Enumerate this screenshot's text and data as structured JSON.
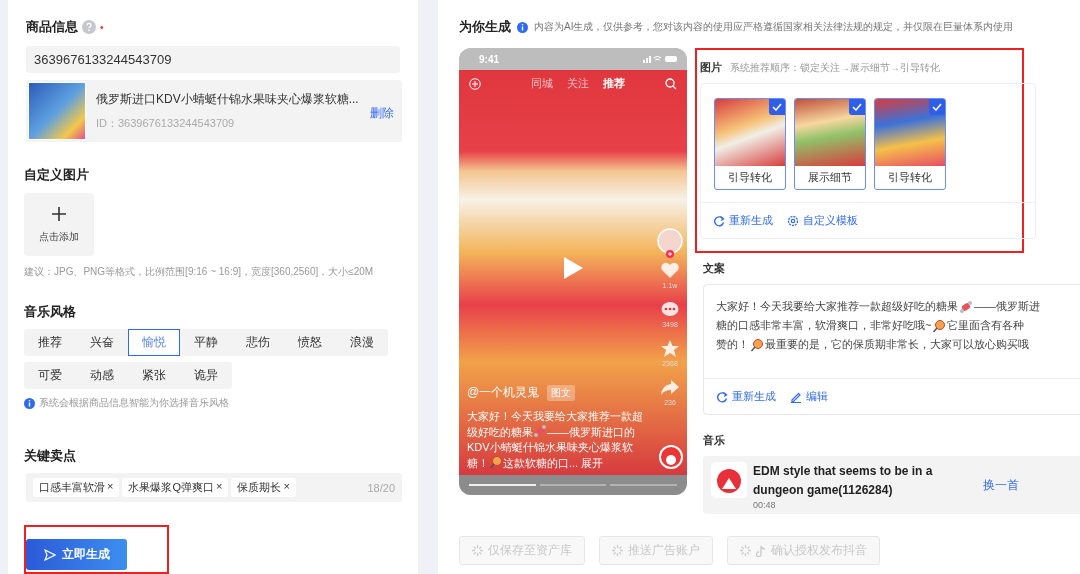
{
  "product": {
    "title": "商品信息",
    "required_mark": "•",
    "id_value": "3639676133244543709",
    "card_name": "俄罗斯进口KDV小蜻蜓什锦水果味夹心爆浆软糖...",
    "card_id": "ID：3639676133244543709",
    "delete_link": "删除"
  },
  "custom_image": {
    "title": "自定义图片",
    "add_label": "点击添加",
    "hint": "建议：JPG、PNG等格式，比例范围[9:16 ~ 16:9]，宽度[360,2560]，大小≤20M"
  },
  "music_style": {
    "title": "音乐风格",
    "rows": [
      [
        {
          "label": "推荐",
          "selected": false
        },
        {
          "label": "兴奋",
          "selected": false
        },
        {
          "label": "愉悦",
          "selected": true
        },
        {
          "label": "平静",
          "selected": false
        },
        {
          "label": "悲伤",
          "selected": false
        },
        {
          "label": "愤怒",
          "selected": false
        },
        {
          "label": "浪漫",
          "selected": false
        }
      ],
      [
        {
          "label": "可爱",
          "selected": false
        },
        {
          "label": "动感",
          "selected": false
        },
        {
          "label": "紧张",
          "selected": false
        },
        {
          "label": "诡异",
          "selected": false
        }
      ]
    ],
    "note": "系统会根据商品信息智能为你选择音乐风格"
  },
  "selling_points": {
    "title": "关键卖点",
    "tags": [
      "口感丰富软滑",
      "水果爆浆Q弹爽口",
      "保质期长"
    ],
    "remove_mark": "×",
    "count": "18/20"
  },
  "generate_button": {
    "label": "立即生成"
  },
  "result": {
    "title": "为你生成",
    "notice": "内容为AI生成，仅供参考，您对该内容的使用应严格遵循国家相关法律法规的规定，并仅限在巨量体系内使用"
  },
  "phone": {
    "time": "9:41",
    "tabs": [
      {
        "label": "同城",
        "selected": false
      },
      {
        "label": "关注",
        "selected": false
      },
      {
        "label": "推荐",
        "selected": true
      }
    ],
    "counts": [
      "1.1w",
      "3498",
      "2368",
      "236"
    ],
    "author": "@一个机灵鬼",
    "badge": "图文",
    "caption": [
      {
        "kind": "text",
        "text": "大家好！今天我要给大家推荐一款超级好吃的糖果"
      },
      {
        "kind": "candy"
      },
      {
        "kind": "text",
        "text": "——俄罗斯进口的KDV小蜻蜓什锦水果味夹心爆浆软糖！"
      },
      {
        "kind": "lollipop"
      },
      {
        "kind": "text",
        "text": "这款软糖的口... "
      },
      {
        "kind": "link",
        "text": "展开"
      }
    ]
  },
  "images": {
    "title": "图片",
    "order_hint": "系统推荐顺序：锁定关注→展示细节→引导转化",
    "items": [
      {
        "label": "引导转化",
        "checked": true
      },
      {
        "label": "展示细节",
        "checked": true
      },
      {
        "label": "引导转化",
        "checked": true
      }
    ],
    "actions": [
      "重新生成",
      "自定义模板"
    ]
  },
  "copy": {
    "title": "文案",
    "lines": [
      [
        {
          "kind": "text",
          "text": "大家好！今天我要给大家推荐一款超级好吃的糖果"
        },
        {
          "kind": "candy"
        },
        {
          "kind": "text",
          "text": "——俄罗斯进"
        }
      ],
      [
        {
          "kind": "text",
          "text": "糖的口感非常丰富，软滑爽口，非常好吃哦~ "
        },
        {
          "kind": "lollipop"
        },
        {
          "kind": "text",
          "text": "它里面含有各种"
        }
      ],
      [
        {
          "kind": "text",
          "text": "赞的！ "
        },
        {
          "kind": "lollipop"
        },
        {
          "kind": "text",
          "text": "最重要的是，它的保质期非常长，大家可以放心购买哦"
        }
      ]
    ],
    "actions": [
      "重新生成",
      "编辑"
    ]
  },
  "music": {
    "title": "音乐",
    "track": "EDM style that seems to be in a dungeon game(1126284)",
    "duration": "00:48",
    "change": "换一首"
  },
  "bottom_buttons": [
    {
      "label": "仅保存至资产库",
      "disabled": true,
      "kind": "plain"
    },
    {
      "label": "推送广告账户",
      "disabled": true,
      "kind": "plain"
    },
    {
      "label": "确认授权发布抖音",
      "disabled": true,
      "kind": "music"
    }
  ]
}
